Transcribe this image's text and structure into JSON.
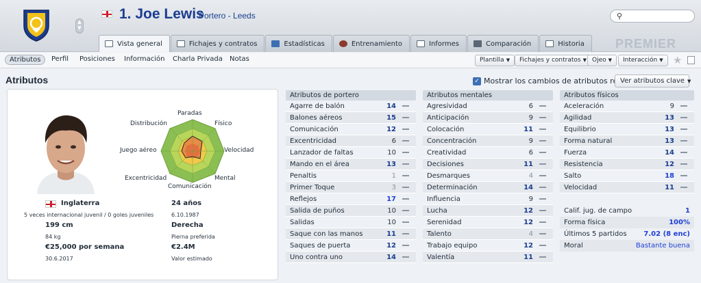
{
  "header": {
    "name": "1. Joe Lewis",
    "subtitle": "Portero - Leeds",
    "search_placeholder": "",
    "league_watermark": "PREMIER",
    "accent": "#1a3d8f"
  },
  "tabs": [
    "Vista general",
    "Fichajes y contratos",
    "Estadísticas",
    "Entrenamiento",
    "Informes",
    "Comparación",
    "Historia"
  ],
  "subnav": {
    "items": [
      "Atributos",
      "Perfil",
      "Posiciones",
      "Información",
      "Charla Privada",
      "Notas"
    ],
    "dropdowns": [
      "Plantilla",
      "Fichajes y contratos",
      "Ojeo",
      "Interacción"
    ]
  },
  "section": {
    "title": "Atributos",
    "show_changes": "Mostrar los cambios de atributos recientes",
    "view_key": "Ver atributos clave"
  },
  "radar": {
    "labels": {
      "paradas": "Paradas",
      "fisico": "Físico",
      "velocidad": "Velocidad",
      "mental": "Mental",
      "comunicacion": "Comunicación",
      "excentricidad": "Excentricidad",
      "juego_aereo": "Juego aéreo",
      "distribucion": "Distribución"
    }
  },
  "info": {
    "nation": "Inglaterra",
    "caps": "5 veces internacional juvenil / 0 goles juveniles",
    "age": "24 años",
    "dob": "6.10.1987",
    "height": "199 cm",
    "weight": "84 kg",
    "foot": "Derecha",
    "foot_label": "Pierna preferida",
    "wage": "€25,000 por semana",
    "contract": "30.6.2017",
    "value": "€2.4M",
    "value_label": "Valor estimado"
  },
  "goalkeeping": {
    "title": "Atributos de portero",
    "rows": [
      {
        "name": "Agarre de balón",
        "value": "14"
      },
      {
        "name": "Balones aéreos",
        "value": "15"
      },
      {
        "name": "Comunicación",
        "value": "12"
      },
      {
        "name": "Excentricidad",
        "value": "6"
      },
      {
        "name": "Lanzador de faltas",
        "value": "10"
      },
      {
        "name": "Mando en el área",
        "value": "13"
      },
      {
        "name": "Penaltis",
        "value": "1"
      },
      {
        "name": "Primer Toque",
        "value": "3"
      },
      {
        "name": "Reflejos",
        "value": "17"
      },
      {
        "name": "Salida de puños",
        "value": "10"
      },
      {
        "name": "Salidas",
        "value": "10"
      },
      {
        "name": "Saque con las manos",
        "value": "11"
      },
      {
        "name": "Saques de puerta",
        "value": "12"
      },
      {
        "name": "Uno contra uno",
        "value": "14"
      }
    ]
  },
  "mental": {
    "title": "Atributos mentales",
    "rows": [
      {
        "name": "Agresividad",
        "value": "6"
      },
      {
        "name": "Anticipación",
        "value": "9"
      },
      {
        "name": "Colocación",
        "value": "11"
      },
      {
        "name": "Concentración",
        "value": "9"
      },
      {
        "name": "Creatividad",
        "value": "6"
      },
      {
        "name": "Decisiones",
        "value": "11"
      },
      {
        "name": "Desmarques",
        "value": "4"
      },
      {
        "name": "Determinación",
        "value": "14"
      },
      {
        "name": "Influencia",
        "value": "9"
      },
      {
        "name": "Lucha",
        "value": "12"
      },
      {
        "name": "Serenidad",
        "value": "12"
      },
      {
        "name": "Talento",
        "value": "4"
      },
      {
        "name": "Trabajo equipo",
        "value": "12"
      },
      {
        "name": "Valentía",
        "value": "11"
      }
    ]
  },
  "physical": {
    "title": "Atributos físicos",
    "rows": [
      {
        "name": "Aceleración",
        "value": "9"
      },
      {
        "name": "Agilidad",
        "value": "13"
      },
      {
        "name": "Equilibrio",
        "value": "13"
      },
      {
        "name": "Forma natural",
        "value": "13"
      },
      {
        "name": "Fuerza",
        "value": "14"
      },
      {
        "name": "Resistencia",
        "value": "12"
      },
      {
        "name": "Salto",
        "value": "18"
      },
      {
        "name": "Velocidad",
        "value": "11"
      }
    ]
  },
  "status": [
    {
      "name": "Calif. jug. de campo",
      "value": "1"
    },
    {
      "name": "Forma física",
      "value": "100%"
    },
    {
      "name": "Últimos 5 partidos",
      "value": "7.02 (8 enc)"
    },
    {
      "name": "Moral",
      "value": "Bastante buena"
    }
  ]
}
